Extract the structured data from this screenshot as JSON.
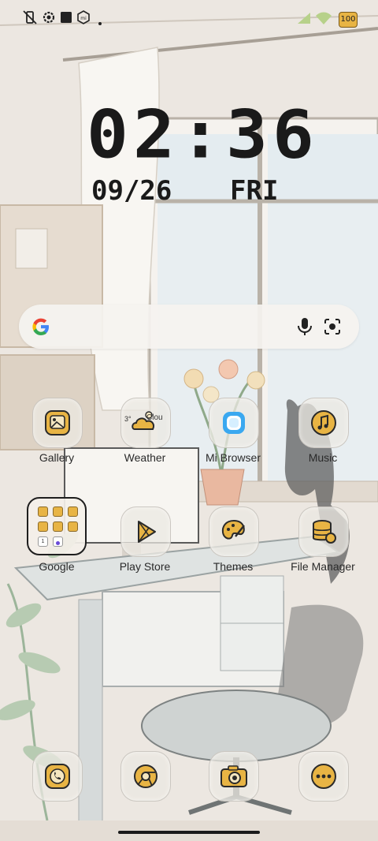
{
  "status_bar": {
    "icons": [
      "vibrate-off-icon",
      "settings-gear-icon",
      "square-notification-icon",
      "mi-logo-icon",
      "dot-icon"
    ],
    "signal": "signal-icon",
    "wifi": "wifi-icon",
    "battery_level": "100"
  },
  "clock": {
    "time": "02:36",
    "date": "09/26",
    "weekday": "FRI"
  },
  "search": {
    "logo": "google-g-icon",
    "mic": "mic-icon",
    "lens": "lens-icon"
  },
  "apps": [
    {
      "label": "Gallery",
      "icon": "gallery-icon"
    },
    {
      "label": "Weather",
      "icon": "weather-icon",
      "detail": "3°",
      "detail2": "Clou"
    },
    {
      "label": "Mi Browser",
      "icon": "browser-icon"
    },
    {
      "label": "Music",
      "icon": "music-icon"
    },
    {
      "label": "Google",
      "icon": "folder-icon"
    },
    {
      "label": "Play Store",
      "icon": "play-store-icon"
    },
    {
      "label": "Themes",
      "icon": "themes-icon"
    },
    {
      "label": "File Manager",
      "icon": "file-manager-icon"
    }
  ],
  "folder_mini": {
    "badge1": "1"
  },
  "dock": [
    {
      "icon": "phone-icon"
    },
    {
      "icon": "chrome-icon"
    },
    {
      "icon": "camera-icon"
    },
    {
      "icon": "more-icon"
    }
  ],
  "colors": {
    "accent_yellow": "#e8b444",
    "icon_outline": "#2a2a2a",
    "wall_base": "#ece7e1"
  }
}
